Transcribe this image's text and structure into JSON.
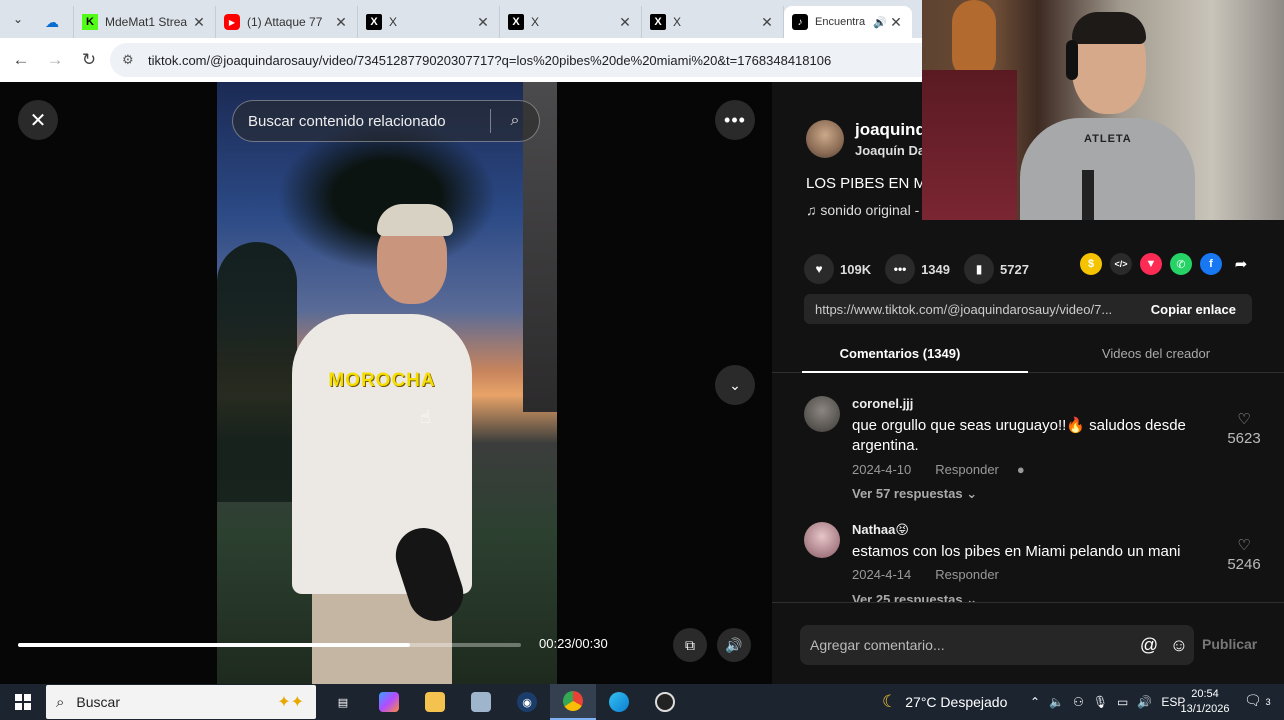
{
  "browser": {
    "tabs": [
      {
        "label": "",
        "icon": "onedrive-icon",
        "color": "#0a6ed1"
      },
      {
        "label": "MdeMat1 Strea",
        "icon": "kick-icon",
        "color": "#53fc18"
      },
      {
        "label": "(1) Attaque 77",
        "icon": "youtube-icon",
        "color": "#ff0000"
      },
      {
        "label": "X",
        "icon": "x-icon",
        "color": "#000000"
      },
      {
        "label": "X",
        "icon": "x-icon",
        "color": "#000000"
      },
      {
        "label": "X",
        "icon": "x-icon",
        "color": "#000000"
      },
      {
        "label": "Encuentra",
        "icon": "tiktok-icon",
        "color": "#000000",
        "active": true
      }
    ],
    "url": "tiktok.com/@joaquindarosauy/video/7345128779020307717?q=los%20pibes%20de%20miami%20&t=1768348418106"
  },
  "video": {
    "search_placeholder": "Buscar contenido relacionado",
    "shirt_text": "MOROCHA",
    "time": "00:23/00:30",
    "progress": 0.78
  },
  "side": {
    "author_name": "joaquind",
    "author_sub": "Joaquín Da",
    "description": "LOS PIBES EN MI",
    "music": "sonido original -",
    "stats": {
      "likes": "109K",
      "comments": "1349",
      "saves": "5727"
    },
    "share_icons": [
      {
        "name": "coin-icon",
        "color": "#f5c400"
      },
      {
        "name": "embed-icon",
        "color": "#2a2a2a"
      },
      {
        "name": "send-icon",
        "color": "#fe2c55"
      },
      {
        "name": "whatsapp-icon",
        "color": "#25d366"
      },
      {
        "name": "facebook-icon",
        "color": "#1877f2"
      },
      {
        "name": "share-arrow-icon",
        "color": "#121212"
      }
    ],
    "link_url": "https://www.tiktok.com/@joaquindarosauy/video/7...",
    "copy_label": "Copiar enlace",
    "tab_comments": "Comentarios (1349)",
    "tab_creator": "Videos del creador",
    "comments": [
      {
        "user": "coronel.jjj",
        "text": "que orgullo que seas uruguayo!!🔥 saludos desde argentina.",
        "date": "2024-4-10",
        "reply": "Responder",
        "more": "Ver 57 respuestas ⌄",
        "likes": "5623"
      },
      {
        "user": "Nathaa😝",
        "text": "estamos con los pibes en Miami pelando un mani",
        "date": "2024-4-14",
        "reply": "Responder",
        "more": "Ver 25 respuestas ⌄",
        "likes": "5246"
      }
    ],
    "composer_placeholder": "Agregar comentario...",
    "publish_label": "Publicar"
  },
  "webcam": {
    "shirt_text": "ATLETA"
  },
  "taskbar": {
    "search_label": "Buscar",
    "weather": "27°C  Despejado",
    "lang": "ESP",
    "time": "20:54",
    "date": "13/1/2026",
    "notif_count": "3"
  }
}
